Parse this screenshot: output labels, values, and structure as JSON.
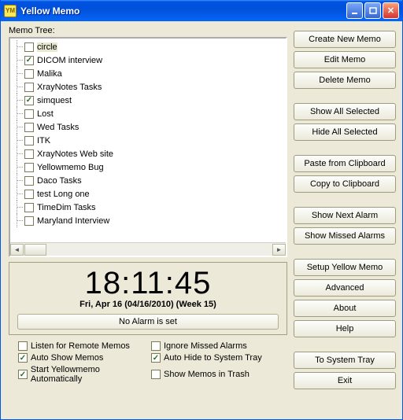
{
  "window": {
    "title": "Yellow Memo"
  },
  "tree": {
    "label": "Memo Tree:",
    "items": [
      {
        "label": "circle",
        "checked": false,
        "selected": true
      },
      {
        "label": "DICOM interview",
        "checked": true
      },
      {
        "label": "Malika",
        "checked": false
      },
      {
        "label": "XrayNotes Tasks",
        "checked": false
      },
      {
        "label": "simquest",
        "checked": true
      },
      {
        "label": "Lost",
        "checked": false
      },
      {
        "label": "Wed Tasks",
        "checked": false
      },
      {
        "label": "ITK",
        "checked": false
      },
      {
        "label": "XrayNotes Web site",
        "checked": false
      },
      {
        "label": "Yellowmemo Bug",
        "checked": false
      },
      {
        "label": "Daco Tasks",
        "checked": false
      },
      {
        "label": "test Long one",
        "checked": false
      },
      {
        "label": "TimeDim Tasks",
        "checked": false
      },
      {
        "label": "Maryland Interview",
        "checked": false
      }
    ]
  },
  "clock": {
    "time": "18:11:45",
    "date": "Fri, Apr 16 (04/16/2010) (Week 15)",
    "alarm_status": "No Alarm is set"
  },
  "options": [
    {
      "label": "Listen for Remote Memos",
      "checked": false
    },
    {
      "label": "Ignore Missed Alarms",
      "checked": false
    },
    {
      "label": "Auto Show Memos",
      "checked": true
    },
    {
      "label": "Auto Hide to System Tray",
      "checked": true
    },
    {
      "label": "Start Yellowmemo Automatically",
      "checked": true
    },
    {
      "label": "Show Memos in Trash",
      "checked": false
    }
  ],
  "buttons": {
    "create": "Create New Memo",
    "edit": "Edit Memo",
    "delete": "Delete Memo",
    "show_sel": "Show All Selected",
    "hide_sel": "Hide All Selected",
    "paste": "Paste from Clipboard",
    "copy": "Copy to Clipboard",
    "next_alarm": "Show Next Alarm",
    "missed": "Show Missed Alarms",
    "setup": "Setup Yellow Memo",
    "advanced": "Advanced",
    "about": "About",
    "help": "Help",
    "tray": "To System Tray",
    "exit": "Exit"
  }
}
